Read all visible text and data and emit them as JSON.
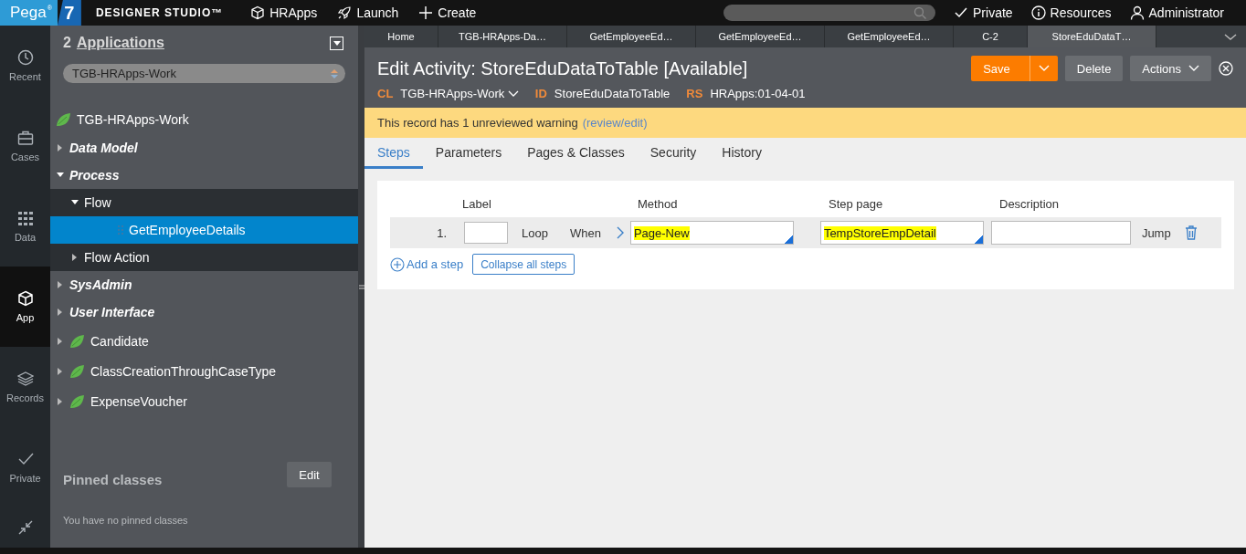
{
  "header": {
    "logo": {
      "name": "Pega",
      "mark": "®",
      "version": "7"
    },
    "product": "DESIGNER STUDIO™",
    "nav": [
      {
        "kind": "app",
        "label": "HRApps"
      },
      {
        "kind": "launch",
        "label": "Launch"
      },
      {
        "kind": "create",
        "label": "Create"
      }
    ],
    "user_menu": [
      {
        "kind": "check",
        "label": "Private"
      },
      {
        "kind": "info",
        "label": "Resources"
      },
      {
        "kind": "user",
        "label": "Administrator"
      }
    ]
  },
  "rail": [
    {
      "kind": "clock",
      "label": "Recent",
      "selected": false
    },
    {
      "kind": "briefcase",
      "label": "Cases",
      "selected": false
    },
    {
      "kind": "grid",
      "label": "Data",
      "selected": false
    },
    {
      "kind": "cube",
      "label": "App",
      "selected": true
    },
    {
      "kind": "layers",
      "label": "Records",
      "selected": false
    },
    {
      "kind": "check",
      "label": "Private",
      "selected": false
    }
  ],
  "explorer": {
    "count": "2",
    "title": "Applications",
    "class_picker": "TGB-HRApps-Work",
    "tree": [
      {
        "kind": "class",
        "label": "TGB-HRApps-Work",
        "selected": false,
        "children": [
          {
            "kind": "category",
            "label": "Data Model",
            "expanded": false,
            "selected": false
          },
          {
            "kind": "category",
            "label": "Process",
            "expanded": true,
            "selected": false,
            "children": [
              {
                "kind": "type",
                "label": "Flow",
                "expanded": true,
                "selected": false,
                "children": [
                  {
                    "kind": "rule",
                    "label": "GetEmployeeDetails",
                    "selected": true
                  }
                ]
              },
              {
                "kind": "type",
                "label": "Flow Action",
                "expanded": false,
                "selected": false
              }
            ]
          },
          {
            "kind": "category",
            "label": "SysAdmin",
            "expanded": false,
            "selected": false
          },
          {
            "kind": "category",
            "label": "User Interface",
            "expanded": false,
            "selected": false
          }
        ]
      },
      {
        "kind": "class",
        "label": "Candidate",
        "expanded": false,
        "selected": false
      },
      {
        "kind": "class",
        "label": "ClassCreationThroughCaseType",
        "expanded": false,
        "selected": false
      },
      {
        "kind": "class",
        "label": "ExpenseVoucher",
        "expanded": false,
        "selected": false
      }
    ],
    "pinned": {
      "title": "Pinned classes",
      "edit": "Edit",
      "empty": "You have no pinned classes"
    }
  },
  "work": {
    "tabs": [
      {
        "label": "Home",
        "selected": false
      },
      {
        "label": "TGB-HRApps-Da…",
        "selected": false
      },
      {
        "label": "GetEmployeeEd…",
        "selected": false
      },
      {
        "label": "GetEmployeeEd…",
        "selected": false
      },
      {
        "label": "GetEmployeeEd…",
        "selected": false
      },
      {
        "label": "C-2",
        "selected": false
      },
      {
        "label": "StoreEduDataT…",
        "selected": true
      }
    ],
    "title": "Edit Activity: StoreEduDataToTable [Available]",
    "buttons": [
      {
        "kind": "split",
        "label": "Save"
      },
      {
        "kind": "plain",
        "label": "Delete"
      },
      {
        "kind": "menu",
        "label": "Actions"
      }
    ],
    "meta": [
      {
        "key": "CL",
        "value": "TGB-HRApps-Work",
        "dropdown": true
      },
      {
        "key": "ID",
        "value": "StoreEduDataToTable",
        "dropdown": false
      },
      {
        "key": "RS",
        "value": "HRApps:01-04-01",
        "dropdown": false
      }
    ],
    "warning": {
      "text": "This record has 1 unreviewed warning",
      "link": "(review/edit)"
    },
    "subtabs": [
      {
        "label": "Steps",
        "selected": true
      },
      {
        "label": "Parameters",
        "selected": false
      },
      {
        "label": "Pages & Classes",
        "selected": false
      },
      {
        "label": "Security",
        "selected": false
      },
      {
        "label": "History",
        "selected": false
      }
    ],
    "steps": {
      "columns": [
        "Label",
        "Method",
        "Step page",
        "Description"
      ],
      "rows": [
        {
          "number": "1.",
          "loop": "Loop",
          "when": "When",
          "method": "Page-New",
          "method_highlighted": true,
          "step_page": "TempStoreEmpDetail",
          "step_page_highlighted": true,
          "jump": "Jump"
        }
      ],
      "add": "Add a step",
      "collapse": "Collapse all steps"
    }
  }
}
